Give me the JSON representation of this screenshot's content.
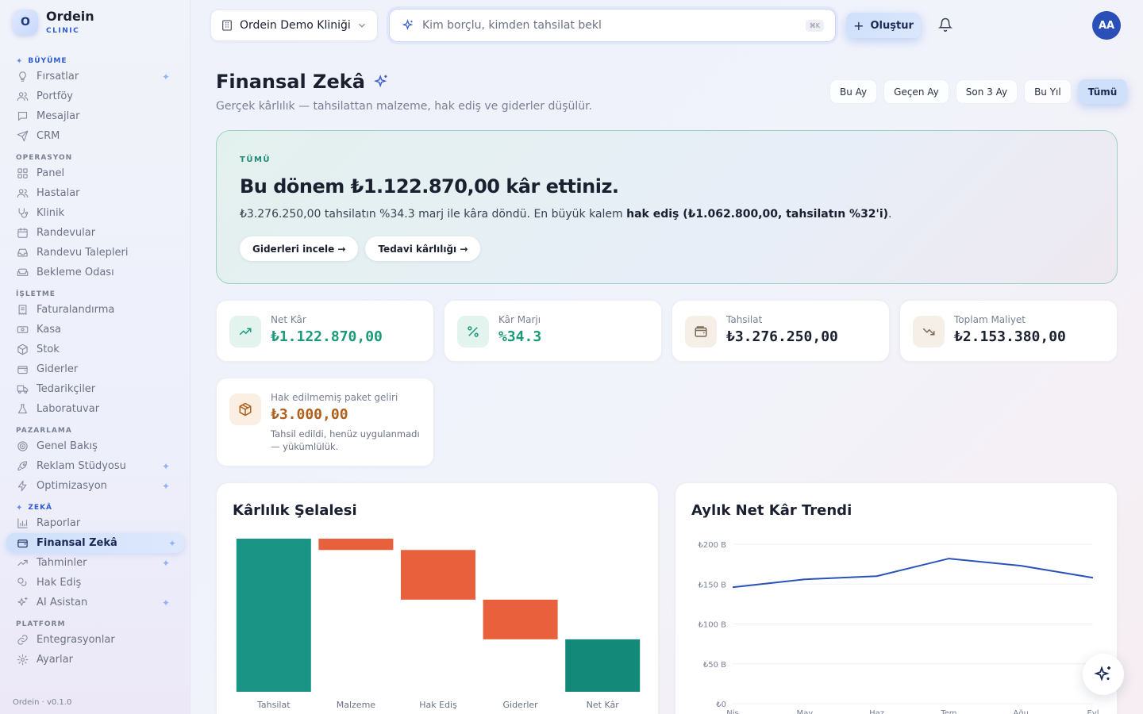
{
  "brand": {
    "logo_letter": "O",
    "name": "Ordein",
    "sub": "CLINIC"
  },
  "sidebar": {
    "sections": [
      {
        "title": "BÜYÜME",
        "accent": true,
        "items": [
          {
            "label": "Fırsatlar",
            "icon": "lightbulb-icon",
            "star": true
          },
          {
            "label": "Portföy",
            "icon": "users-icon"
          },
          {
            "label": "Mesajlar",
            "icon": "message-icon"
          },
          {
            "label": "CRM",
            "icon": "send-icon"
          }
        ]
      },
      {
        "title": "OPERASYON",
        "items": [
          {
            "label": "Panel",
            "icon": "grid-icon"
          },
          {
            "label": "Hastalar",
            "icon": "users-icon"
          },
          {
            "label": "Klinik",
            "icon": "stethoscope-icon"
          },
          {
            "label": "Randevular",
            "icon": "calendar-icon"
          },
          {
            "label": "Randevu Talepleri",
            "icon": "inbox-icon"
          },
          {
            "label": "Bekleme Odası",
            "icon": "sofa-icon"
          }
        ]
      },
      {
        "title": "İŞLETME",
        "items": [
          {
            "label": "Faturalandırma",
            "icon": "receipt-icon"
          },
          {
            "label": "Kasa",
            "icon": "cash-icon"
          },
          {
            "label": "Stok",
            "icon": "package-icon"
          },
          {
            "label": "Giderler",
            "icon": "wallet-icon"
          },
          {
            "label": "Tedarikçiler",
            "icon": "truck-icon"
          },
          {
            "label": "Laboratuvar",
            "icon": "flask-icon"
          }
        ]
      },
      {
        "title": "PAZARLAMA",
        "items": [
          {
            "label": "Genel Bakış",
            "icon": "target-icon"
          },
          {
            "label": "Reklam Stüdyosu",
            "icon": "rocket-icon",
            "star": true
          },
          {
            "label": "Optimizasyon",
            "icon": "bolt-icon",
            "star": true
          }
        ]
      },
      {
        "title": "ZEKÂ",
        "accent": true,
        "items": [
          {
            "label": "Raporlar",
            "icon": "bar-chart-icon"
          },
          {
            "label": "Finansal Zekâ",
            "icon": "wallet-icon",
            "star": true,
            "active": true
          },
          {
            "label": "Tahminler",
            "icon": "trend-icon",
            "star": true
          },
          {
            "label": "Hak Ediş",
            "icon": "coins-icon"
          },
          {
            "label": "AI Asistan",
            "icon": "sparkles-icon",
            "star": true
          }
        ]
      },
      {
        "title": "PLATFORM",
        "items": [
          {
            "label": "Entegrasyonlar",
            "icon": "link-icon"
          },
          {
            "label": "Ayarlar",
            "icon": "gear-icon"
          }
        ]
      }
    ],
    "version": "Ordein · v0.1.0"
  },
  "topbar": {
    "clinic": "Ordein Demo Kliniği",
    "search_placeholder": "Kim borçlu, kimden tahsilat bekl",
    "search_kbd": "⌘K",
    "create_label": "Oluştur",
    "avatar": "AA"
  },
  "page": {
    "title": "Finansal Zekâ",
    "subtitle": "Gerçek kârlılık — tahsilattan malzeme, hak ediş ve giderler düşülür.",
    "periods": [
      "Bu Ay",
      "Geçen Ay",
      "Son 3 Ay",
      "Bu Yıl",
      "Tümü"
    ],
    "active_period": "Tümü"
  },
  "hero": {
    "tag": "TÜMÜ",
    "title": "Bu dönem ₺1.122.870,00 kâr ettiniz.",
    "desc_prefix": "₺3.276.250,00 tahsilatın %34.3 marj ile kâra döndü. En büyük kalem ",
    "desc_bold": "hak ediş (₺1.062.800,00, tahsilatın %32'i)",
    "desc_suffix": ".",
    "btn_expenses": "Giderleri incele →",
    "btn_profit": "Tedavi kârlılığı →"
  },
  "kpis": [
    {
      "label": "Net Kâr",
      "value": "₺1.122.870,00",
      "icon": "trend-up-icon",
      "color": "#1a9a78"
    },
    {
      "label": "Kâr Marjı",
      "value": "%34.3",
      "icon": "percent-icon",
      "color": "#1a9a78"
    },
    {
      "label": "Tahsilat",
      "value": "₺3.276.250,00",
      "icon": "wallet-icon",
      "color": "#1a2030"
    },
    {
      "label": "Toplam Maliyet",
      "value": "₺2.153.380,00",
      "icon": "trend-down-icon",
      "color": "#1a2030"
    }
  ],
  "package": {
    "label": "Hak edilmemiş paket geliri",
    "value": "₺3.000,00",
    "note": "Tahsil edildi, henüz uygulanmadı — yükümlülük.",
    "color": "#b0601a"
  },
  "waterfall": {
    "title": "Kârlılık Şelalesi",
    "chart_data": {
      "type": "bar",
      "categories": [
        "Tahsilat",
        "Malzeme",
        "Hak Ediş",
        "Giderler",
        "Net Kâr"
      ],
      "values": [
        3276250,
        -242000,
        -1062800,
        -848580,
        1122870
      ],
      "colors": {
        "total": "#1a9485",
        "negative": "#e8603c",
        "result": "#13897a"
      }
    }
  },
  "trend": {
    "title": "Aylık Net Kâr Trendi",
    "chart_data": {
      "type": "line",
      "x": [
        "Nis",
        "May",
        "Haz",
        "Tem",
        "Ağu",
        "Eyl"
      ],
      "y": [
        146000,
        156000,
        160000,
        182000,
        173000,
        158000
      ],
      "ylim": [
        0,
        200000
      ],
      "yticks": [
        "₺0",
        "₺50 B",
        "₺100 B",
        "₺150 B",
        "₺200 B"
      ],
      "color": "#2a52b8"
    }
  }
}
